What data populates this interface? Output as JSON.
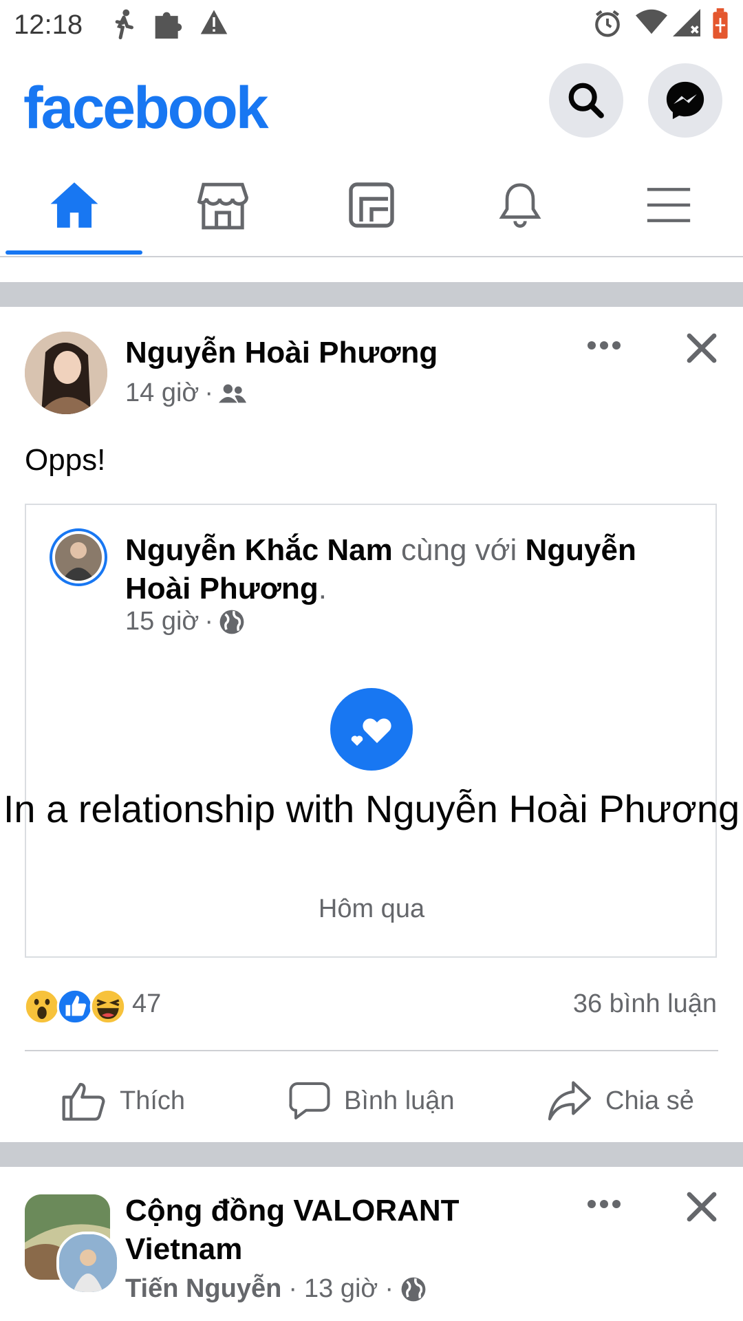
{
  "status_bar": {
    "time": "12:18"
  },
  "header": {
    "logo": "facebook",
    "search_icon": "search-icon",
    "messenger_icon": "messenger-icon"
  },
  "tabs": [
    {
      "name": "home",
      "icon": "home-icon",
      "active": true
    },
    {
      "name": "marketplace",
      "icon": "store-icon",
      "active": false
    },
    {
      "name": "feeds",
      "icon": "feeds-icon",
      "active": false
    },
    {
      "name": "notifications",
      "icon": "bell-icon",
      "active": false
    },
    {
      "name": "menu",
      "icon": "menu-icon",
      "active": false
    }
  ],
  "post1": {
    "author": "Nguyễn Hoài Phương",
    "time": "14 giờ",
    "separator": "·",
    "text": "Opps!",
    "shared": {
      "author": "Nguyễn Khắc Nam",
      "with_text": "cùng với",
      "tagged": "Nguyễn Hoài Phương",
      "period": ".",
      "time": "15 giờ",
      "event_title": "In a relationship with Nguyễn Hoài Phương",
      "event_date": "Hôm qua"
    },
    "reactions_count": "47",
    "comments_count": "36 bình luận",
    "actions": {
      "like": "Thích",
      "comment": "Bình luận",
      "share": "Chia sẻ"
    }
  },
  "post2": {
    "page_name": "Cộng đồng VALORANT Vietnam",
    "poster": "Tiến Nguyễn",
    "time": "13 giờ",
    "separator": "·"
  },
  "colors": {
    "accent": "#1877f2",
    "secondary_text": "#65676b",
    "separator": "#c9ccd1"
  }
}
